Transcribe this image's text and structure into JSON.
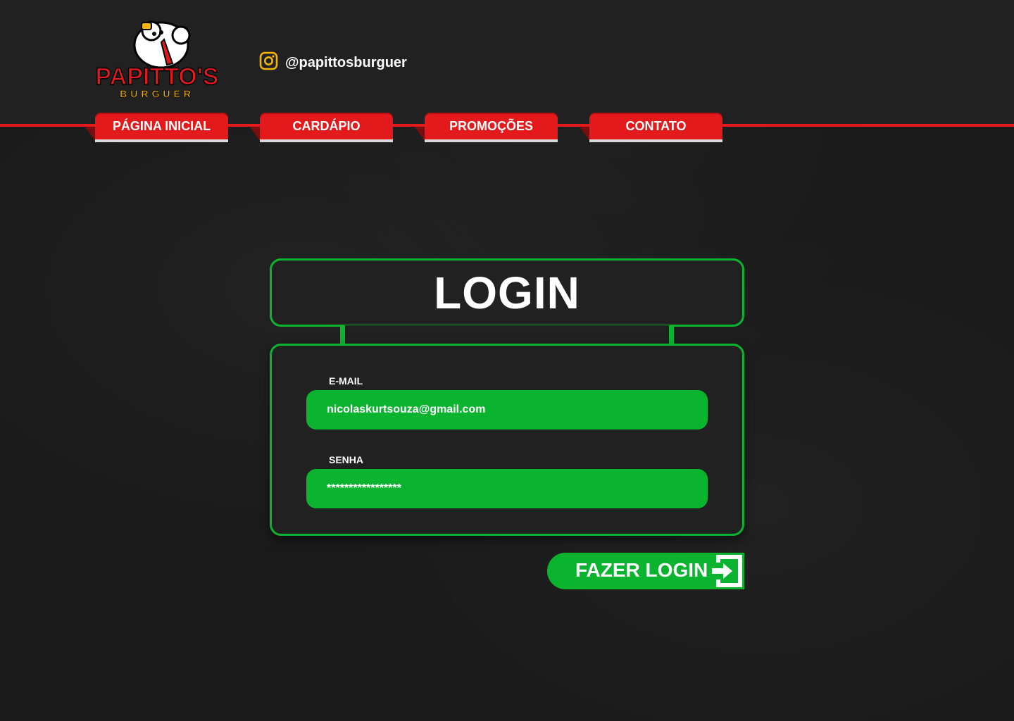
{
  "brand": {
    "logo_line1": "PAPITTO'S",
    "logo_line2": "BURGUER",
    "logo_alt": "Papitto's Burguer logo"
  },
  "social": {
    "instagram_handle": "@papittosburguer",
    "icon": "instagram-icon"
  },
  "nav": {
    "items": [
      {
        "label": "PÁGINA INICIAL"
      },
      {
        "label": "CARDÁPIO"
      },
      {
        "label": "PROMOÇÕES"
      },
      {
        "label": "CONTATO"
      }
    ]
  },
  "login": {
    "title": "LOGIN",
    "email_label": "E-MAIL",
    "email_value": "nicolaskurtsouza@gmail.com",
    "password_label": "SENHA",
    "password_value": "*****************",
    "submit_label": "FAZER LOGIN",
    "submit_icon": "login-arrow-icon"
  },
  "colors": {
    "brand_red": "#e3191b",
    "accent_green": "#0ab42f",
    "header_bg": "#212121",
    "page_bg": "#1a1a1a",
    "logo_yellow": "#f5b400"
  }
}
